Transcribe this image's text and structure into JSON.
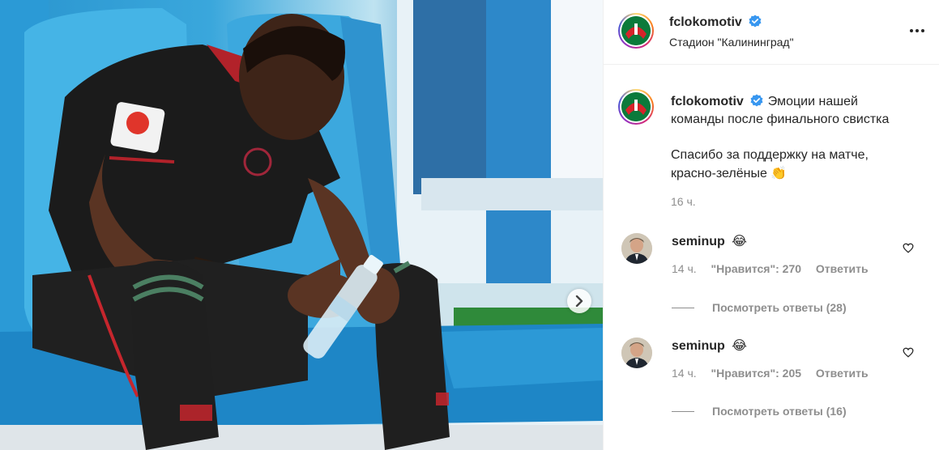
{
  "post": {
    "username": "fclokomotiv",
    "location": "Стадион \"Калининград\"",
    "caption_line1": "Эмоции нашей",
    "caption_line2": "команды после финального свистка",
    "caption_line3": "Спасибо за поддержку на матче,",
    "caption_line4": "красно-зелёные",
    "caption_emoji": "👏",
    "time": "16 ч."
  },
  "comments": [
    {
      "username": "seminup",
      "text_emoji": "😂",
      "time": "14 ч.",
      "likes": "\"Нравится\": 270",
      "reply": "Ответить",
      "view_replies": "Посмотреть ответы (28)"
    },
    {
      "username": "seminup",
      "text_emoji": "😂",
      "time": "14 ч.",
      "likes": "\"Нравится\": 205",
      "reply": "Ответить",
      "view_replies": "Посмотреть ответы (16)"
    }
  ],
  "icons": {
    "verified": "verified-badge-icon",
    "more": "more-options-icon",
    "heart": "heart-icon",
    "next": "chevron-right-icon"
  },
  "colors": {
    "verified_blue": "#3897f0",
    "club_green": "#0b7a3b",
    "club_red": "#d6232a"
  }
}
